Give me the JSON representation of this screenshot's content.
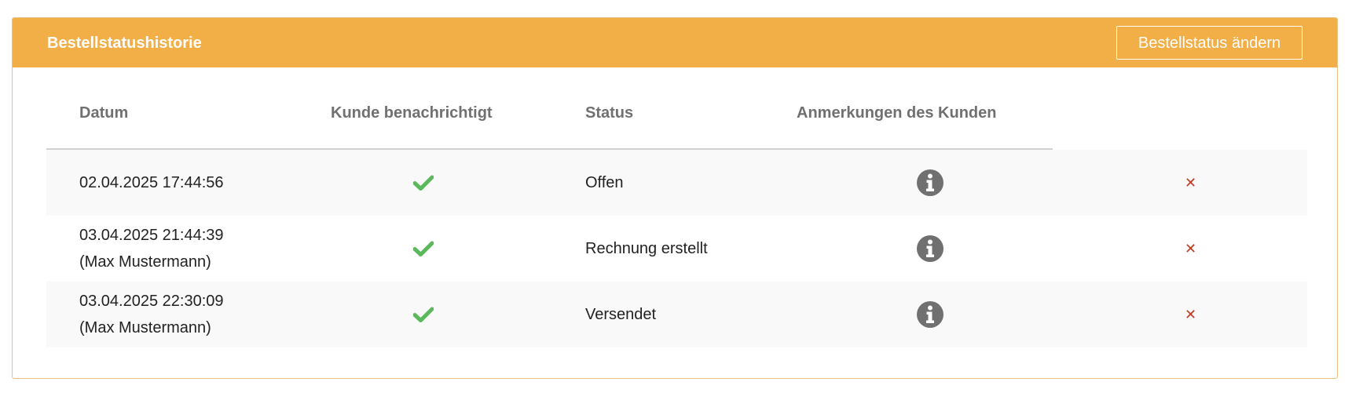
{
  "panel": {
    "title": "Bestellstatushistorie",
    "change_status_label": "Bestellstatus ändern"
  },
  "table": {
    "headers": {
      "date": "Datum",
      "notified": "Kunde benachrichtigt",
      "status": "Status",
      "comments": "Anmerkungen des Kunden"
    },
    "rows": [
      {
        "date": "02.04.2025 17:44:56",
        "user": "",
        "notified_icon": "check-icon",
        "status": "Offen",
        "comment_icon": "info-icon",
        "delete_icon": "close-icon"
      },
      {
        "date": "03.04.2025 21:44:39",
        "user": "(Max Mustermann)",
        "notified_icon": "check-icon",
        "status": "Rechnung erstellt",
        "comment_icon": "info-icon",
        "delete_icon": "close-icon"
      },
      {
        "date": "03.04.2025 22:30:09",
        "user": "(Max Mustermann)",
        "notified_icon": "check-icon",
        "status": "Versendet",
        "comment_icon": "info-icon",
        "delete_icon": "close-icon"
      }
    ]
  },
  "colors": {
    "header_bg": "#f2ae47",
    "check": "#5cb85c",
    "info": "#707070",
    "delete": "#c23b22"
  }
}
